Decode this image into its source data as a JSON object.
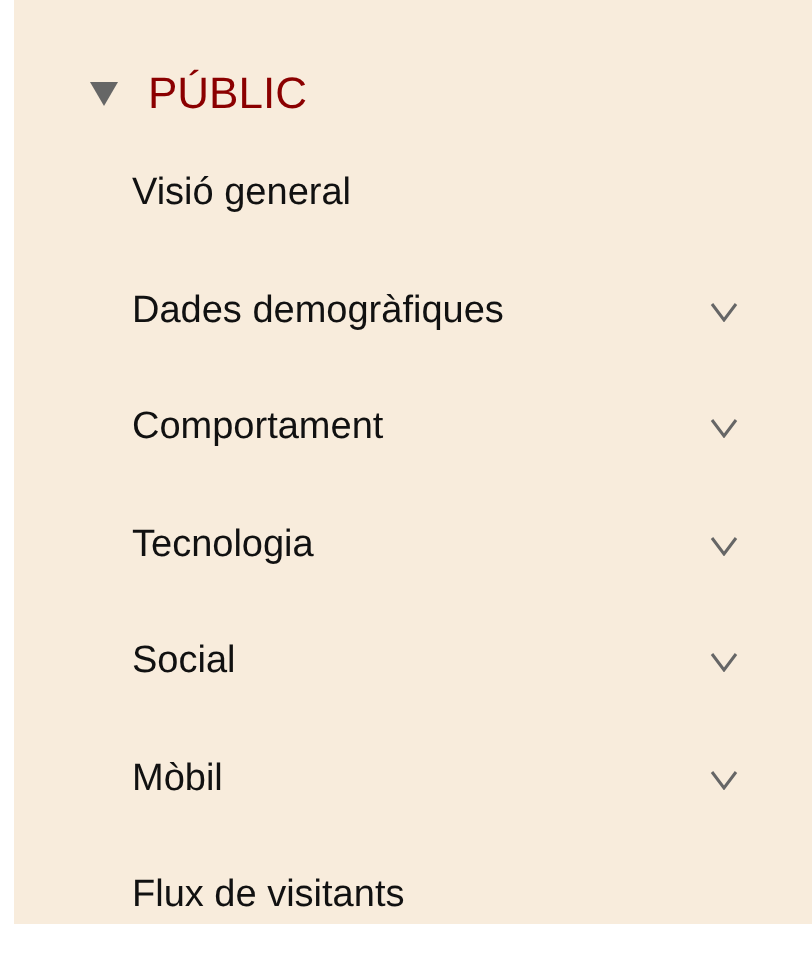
{
  "section": {
    "title": "PÚBLIC",
    "expanded": true,
    "items": [
      {
        "label": "Visió general",
        "expandable": false
      },
      {
        "label": "Dades demogràfiques",
        "expandable": true
      },
      {
        "label": "Comportament",
        "expandable": true
      },
      {
        "label": "Tecnologia",
        "expandable": true
      },
      {
        "label": "Social",
        "expandable": true
      },
      {
        "label": "Mòbil",
        "expandable": true
      },
      {
        "label": "Flux de visitants",
        "expandable": false
      }
    ]
  }
}
